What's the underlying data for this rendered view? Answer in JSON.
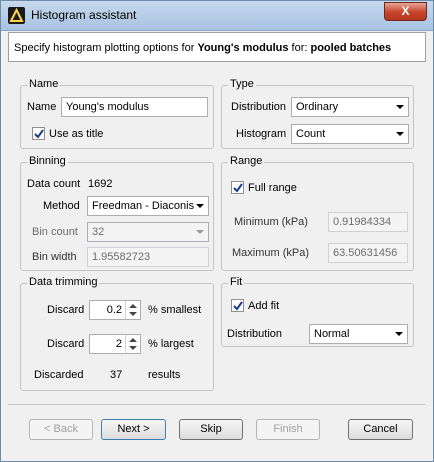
{
  "window": {
    "title": "Histogram assistant",
    "close_label": "X"
  },
  "header": {
    "prefix": "Specify histogram plotting options for ",
    "property": "Young's modulus",
    "for_label": " for: ",
    "dataset": "pooled batches"
  },
  "name_group": {
    "title": "Name",
    "name_label": "Name",
    "name_value": "Young's modulus",
    "use_as_title_label": "Use as title",
    "use_as_title_checked": true
  },
  "type_group": {
    "title": "Type",
    "distribution_label": "Distribution",
    "distribution_value": "Ordinary",
    "histogram_label": "Histogram",
    "histogram_value": "Count"
  },
  "binning_group": {
    "title": "Binning",
    "data_count_label": "Data count",
    "data_count_value": "1692",
    "method_label": "Method",
    "method_value": "Freedman - Diaconis",
    "bin_count_label": "Bin count",
    "bin_count_value": "32",
    "bin_width_label": "Bin width",
    "bin_width_value": "1.95582723"
  },
  "range_group": {
    "title": "Range",
    "full_range_label": "Full range",
    "full_range_checked": true,
    "minimum_label": "Minimum (kPa)",
    "minimum_value": "0.91984334",
    "maximum_label": "Maximum (kPa)",
    "maximum_value": "63.50631456"
  },
  "trimming_group": {
    "title": "Data trimming",
    "discard_label_1": "Discard",
    "smallest_value": "0.2",
    "smallest_suffix": "% smallest",
    "discard_label_2": "Discard",
    "largest_value": "2",
    "largest_suffix": "% largest",
    "discarded_label": "Discarded",
    "discarded_value": "37",
    "results_label": "results"
  },
  "fit_group": {
    "title": "Fit",
    "add_fit_label": "Add fit",
    "add_fit_checked": true,
    "distribution_label": "Distribution",
    "distribution_value": "Normal"
  },
  "buttons": {
    "back": "< Back",
    "next": "Next >",
    "skip": "Skip",
    "finish": "Finish",
    "cancel": "Cancel"
  }
}
